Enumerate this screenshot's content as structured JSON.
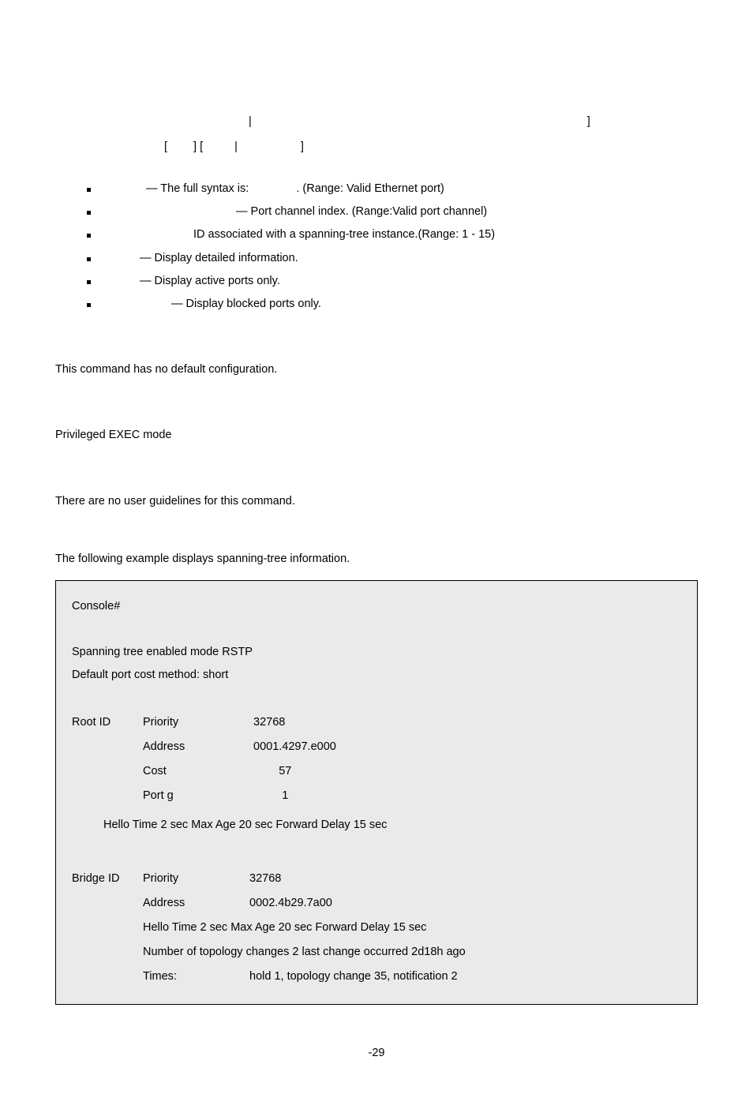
{
  "syntax": {
    "line1_parts": [
      "|",
      "]"
    ],
    "line2_parts": [
      "[",
      "] [",
      "|",
      "]"
    ]
  },
  "items": [
    {
      "pre": "",
      "mid": " — The full syntax is: ",
      "tail": ". (Range: Valid Ethernet port)",
      "pre_w": 36,
      "mid_gap_w": 56
    },
    {
      "pre": "",
      "mid": " — Port channel index. (Range:Valid port channel)",
      "tail": "",
      "pre_w": 150,
      "mid_gap_w": 0
    },
    {
      "pre": "",
      "mid": "ID associated with a spanning-tree instance.(Range: 1 - 15)",
      "tail": "",
      "pre_w": 100,
      "mid_gap_w": 0
    },
    {
      "pre": "",
      "mid": " — Display detailed information.",
      "tail": "",
      "pre_w": 28,
      "mid_gap_w": 0
    },
    {
      "pre": "",
      "mid": " — Display active ports only.",
      "tail": "",
      "pre_w": 28,
      "mid_gap_w": 0
    },
    {
      "pre": "",
      "mid": " — Display blocked ports only.",
      "tail": "",
      "pre_w": 68,
      "mid_gap_w": 0
    }
  ],
  "p1": "This command has no default configuration.",
  "p2": "Privileged EXEC mode",
  "p3": "There are no user guidelines for this command.",
  "p4": "The following example displays spanning-tree information.",
  "console": {
    "prompt": "Console#",
    "l1": "Spanning tree enabled mode RSTP",
    "l2": "Default port cost method: short",
    "root_label": "Root ID",
    "root": [
      {
        "k": "Priority",
        "v": "32768"
      },
      {
        "k": "Address",
        "v": "0001.4297.e000"
      },
      {
        "k": "Cost",
        "v": "        57"
      },
      {
        "k": "Port g",
        "v": "         1"
      }
    ],
    "l3": "Hello Time 2 sec Max Age 20 sec Forward Delay 15 sec",
    "bridge_label": "Bridge ID",
    "bridge": [
      {
        "k": "Priority",
        "v": "32768"
      },
      {
        "k": "Address",
        "v": "0002.4b29.7a00"
      }
    ],
    "l4": "Hello Time 2 sec Max Age 20 sec Forward Delay 15 sec",
    "l5": "Number of topology changes 2 last change occurred 2d18h ago",
    "l6k": "Times:",
    "l6v": "hold 1, topology change 35, notification 2"
  },
  "page_num": "-29"
}
